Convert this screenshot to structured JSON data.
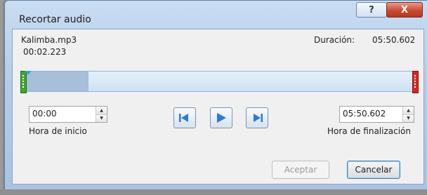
{
  "window": {
    "title": "Recortar audio",
    "help_label": "?",
    "close_label": "X"
  },
  "file": {
    "name": "Kalimba.mp3",
    "position": "00:02.223"
  },
  "duration": {
    "label": "Duración:",
    "value": "05:50.602"
  },
  "track": {
    "played_fraction": 0.17
  },
  "start": {
    "value": "00:00",
    "label": "Hora de inicio"
  },
  "end": {
    "value": "05:50.602",
    "label": "Hora de finalización"
  },
  "transport": {
    "previous": "previous-frame-icon",
    "play": "play-icon",
    "next": "next-frame-icon"
  },
  "buttons": {
    "ok": "Aceptar",
    "cancel": "Cancelar"
  },
  "colors": {
    "start_marker": "#3caa2c",
    "end_marker": "#d6281e",
    "track": "#cfe1f4",
    "transport_icon": "#2b7bd3"
  }
}
